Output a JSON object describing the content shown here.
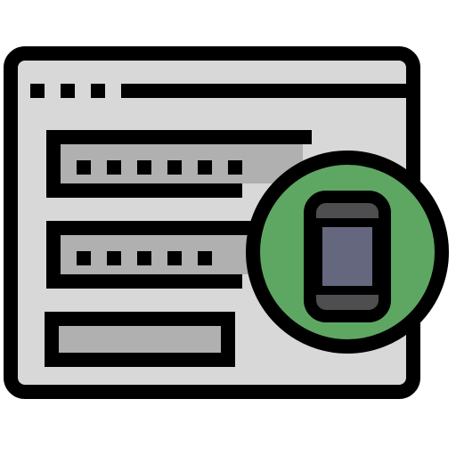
{
  "icon": {
    "name": "mobile-login-form-icon",
    "colors": {
      "outline": "#000000",
      "window_fill": "#d8d8d8",
      "field_fill": "#b0b0b0",
      "badge_fill": "#5ea763",
      "phone_body": "#4e4e50",
      "phone_screen": "#64677d",
      "background": "#ffffff"
    },
    "window_controls": {
      "count": 3
    },
    "password_fields": [
      {
        "masked_dots": 6
      },
      {
        "masked_dots": 5
      }
    ],
    "button": {
      "label": ""
    }
  }
}
